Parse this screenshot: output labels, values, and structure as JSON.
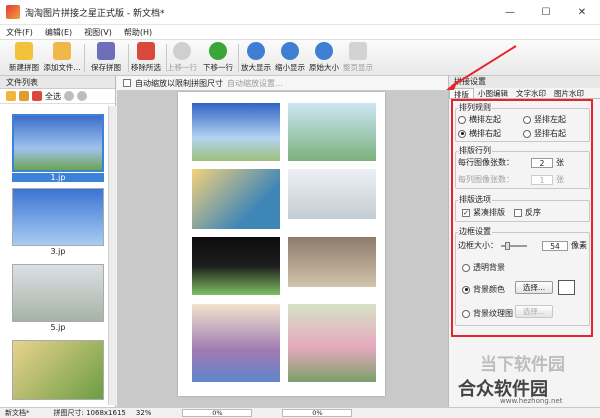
{
  "window": {
    "title": "淘淘图片拼接之星正式版 - 新文档*",
    "min": "—",
    "max": "☐",
    "close": "✕"
  },
  "menu": [
    "文件(F)",
    "编辑(E)",
    "视图(V)",
    "帮助(H)"
  ],
  "toolbar": [
    {
      "label": "新建拼图"
    },
    {
      "label": "添加文件..."
    },
    {
      "label": "保存拼图"
    },
    {
      "label": "移除所选"
    },
    {
      "label": "上移一行"
    },
    {
      "label": "下移一行"
    },
    {
      "label": "放大显示"
    },
    {
      "label": "缩小显示"
    },
    {
      "label": "原始大小"
    },
    {
      "label": "整页显示"
    }
  ],
  "file_list": {
    "title": "文件列表",
    "select_all": "全选",
    "items": [
      "1.jp",
      "3.jp",
      "5.jp"
    ]
  },
  "canvas": {
    "auto_zoom_label": "自动缩放以限制拼图尺寸",
    "auto_zoom_settings": "自动缩放设置..."
  },
  "right_panel": {
    "title": "拼接设置",
    "tabs": [
      "排版",
      "小图编辑",
      "文字水印",
      "图片水印"
    ],
    "order": {
      "title": "排列规则",
      "opt1": "横排左起",
      "opt2": "竖排左起",
      "opt3": "横排右起",
      "opt4": "竖排右起"
    },
    "rows": {
      "title": "排版行列",
      "per_row_label": "每行图像张数：",
      "per_row": "2",
      "per_col_label": "每列图像张数：",
      "per_col": "1",
      "unit": "张"
    },
    "options": {
      "title": "排版选项",
      "compact": "紧凑排版",
      "reverse": "反序"
    },
    "border": {
      "title": "边框设置",
      "size_label": "边框大小：",
      "size": "54",
      "unit": "像素",
      "transparent": "透明背景",
      "bg_color": "背景颜色",
      "bg_texture": "背景纹理图",
      "choose": "选择..."
    }
  },
  "status": {
    "doc": "新文档*",
    "size": "拼图尺寸: 1068x1615",
    "zoom": "32%",
    "p1": "0%",
    "p2": "0%"
  },
  "watermark": {
    "line1": "当下软件园",
    "line2": "合众软件园",
    "url": "www.hezhong.net"
  },
  "colors": {
    "accent": "#e8232b"
  }
}
